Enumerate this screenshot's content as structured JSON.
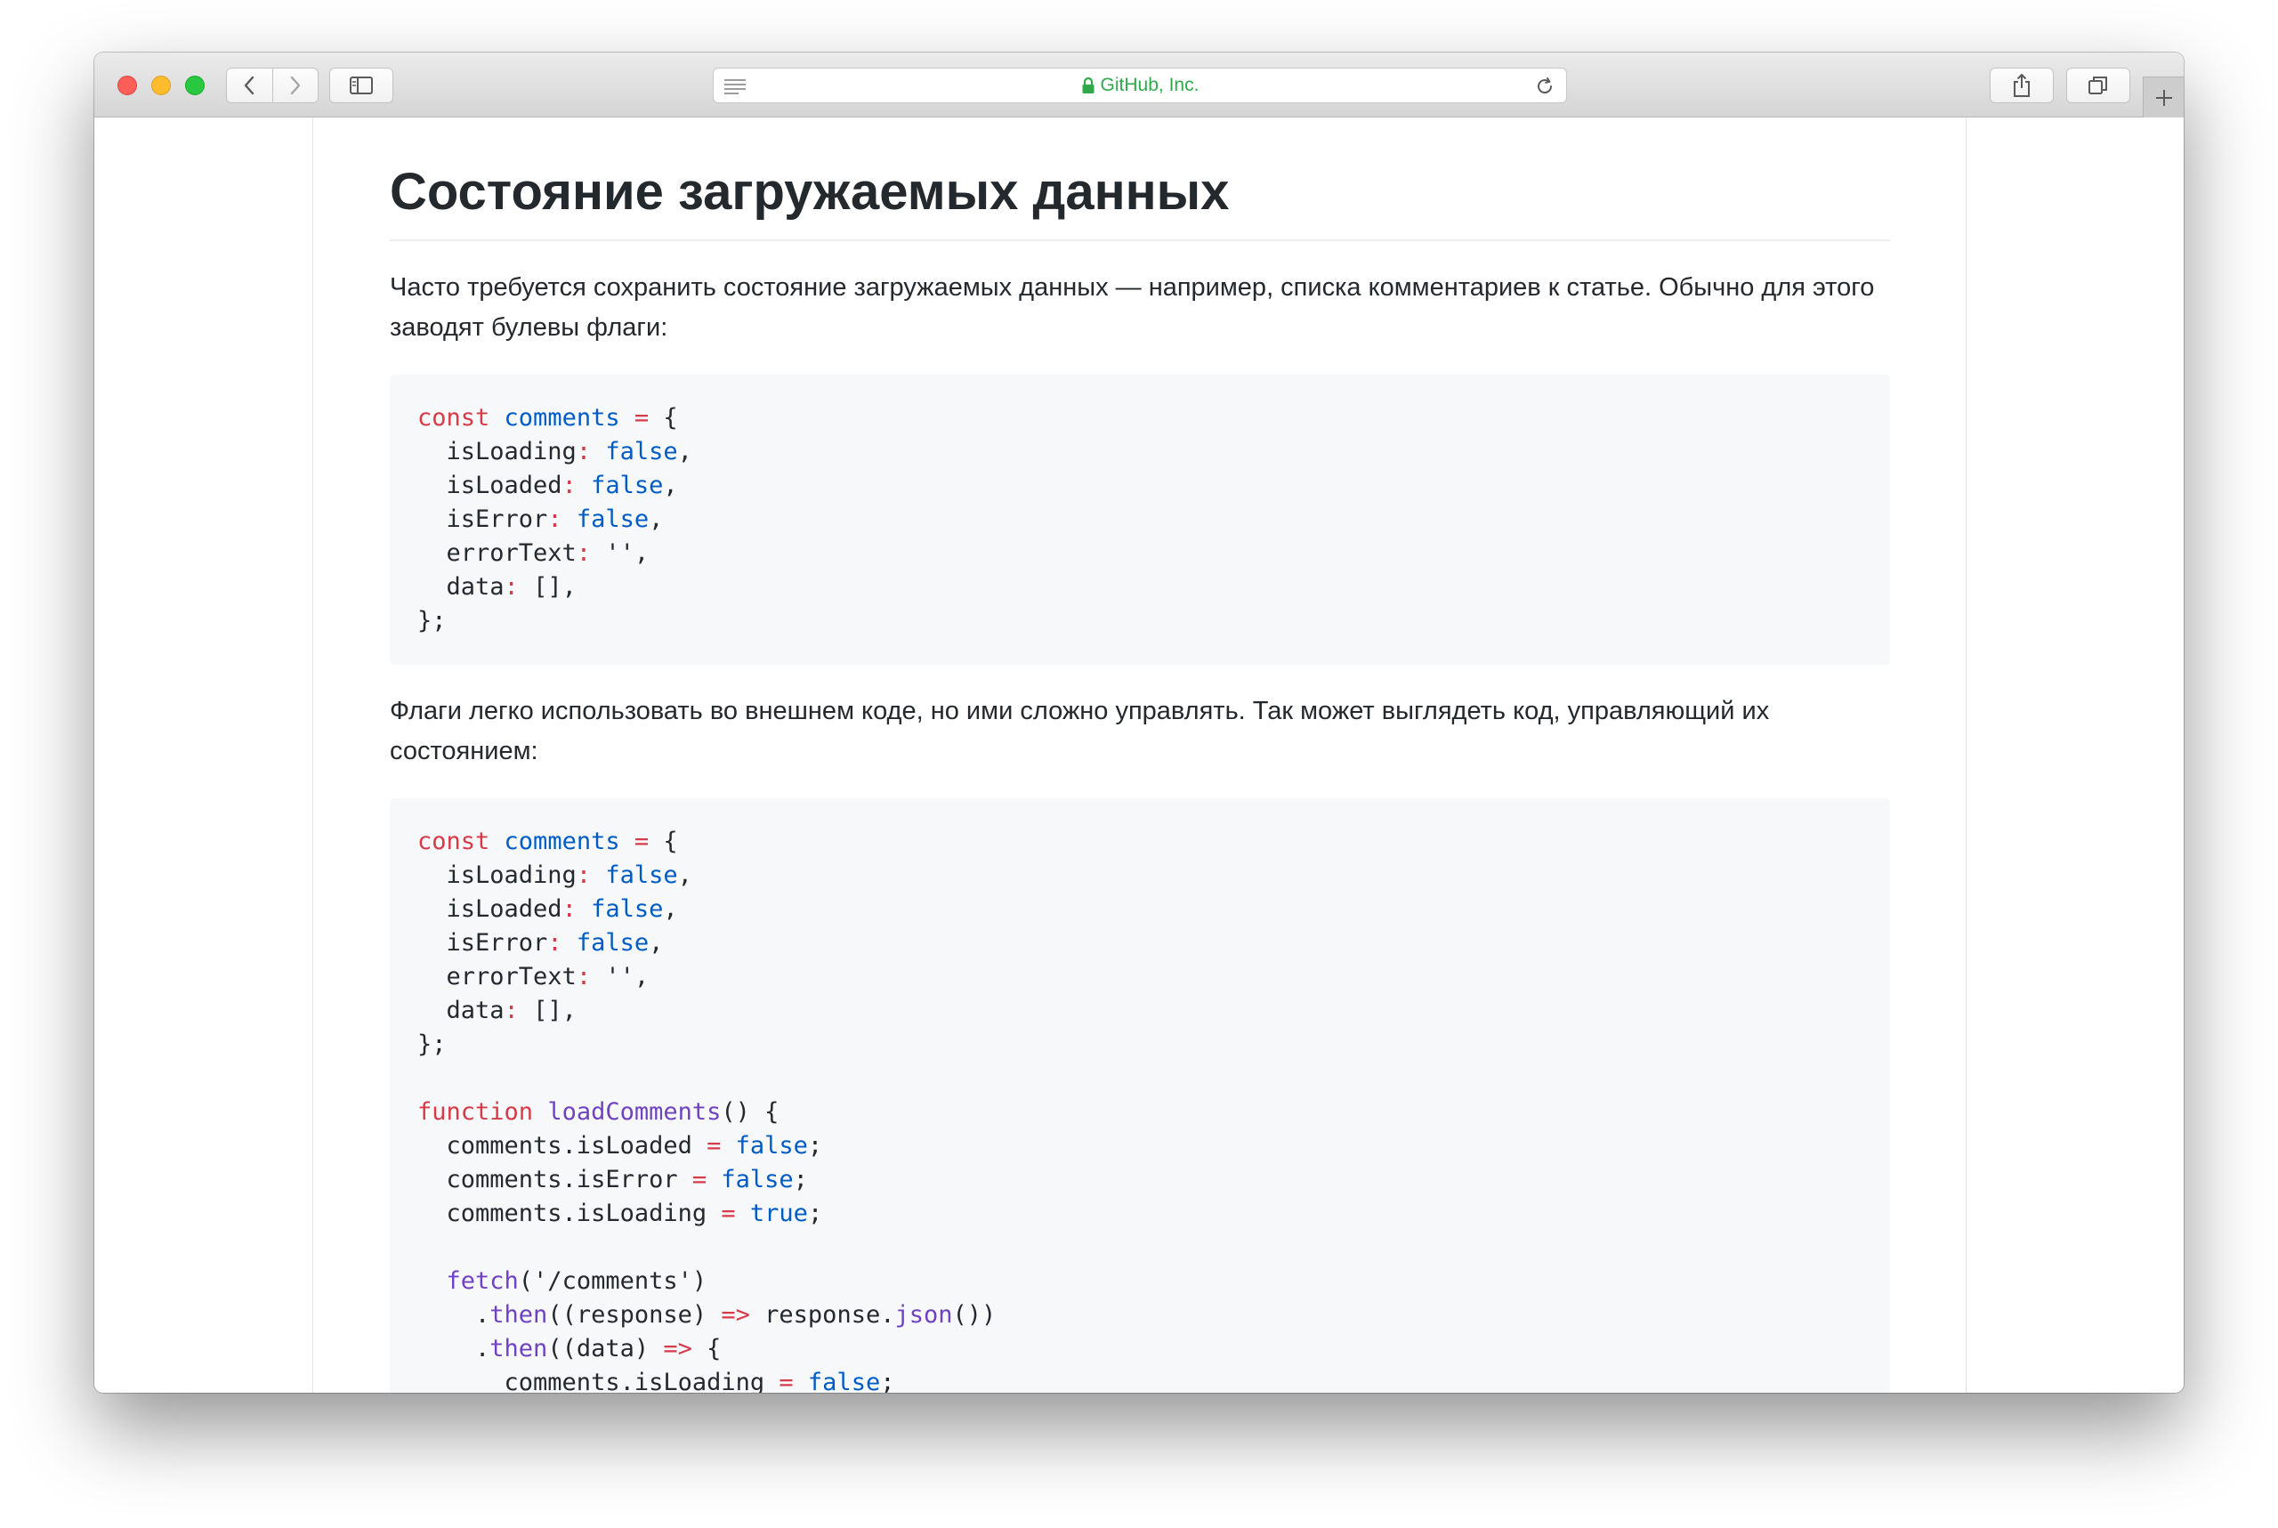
{
  "browser": {
    "site_name": "GitHub, Inc.",
    "icons": {
      "back": "chevron-left-icon",
      "forward": "chevron-right-icon",
      "sidebar": "sidebar-icon",
      "reader": "reader-icon",
      "lock": "lock-icon",
      "reload": "reload-icon",
      "share": "share-icon",
      "tabs": "tabs-overview-icon",
      "new_tab": "plus-icon"
    },
    "colors": {
      "site_label": "#2fa94a",
      "close": "#fc5f57",
      "minimize": "#fdbc2e",
      "zoom": "#28c840"
    }
  },
  "article": {
    "title": "Состояние загружаемых данных",
    "paragraph_1": "Часто требуется сохранить состояние загружаемых данных — например, списка комментариев к статье. Обычно для этого заводят булевы флаги:",
    "paragraph_2": "Флаги легко использовать во внешнем коде, но ими сложно управлять. Так может выглядеть код, управляющий их состоянием:",
    "code_1": {
      "l1": [
        "const",
        " ",
        "comments",
        " ",
        "=",
        " {"
      ],
      "l2": [
        "  isLoading",
        ":",
        " ",
        "false",
        ","
      ],
      "l3": [
        "  isLoaded",
        ":",
        " ",
        "false",
        ","
      ],
      "l4": [
        "  isError",
        ":",
        " ",
        "false",
        ","
      ],
      "l5": [
        "  errorText",
        ":",
        " '',"
      ],
      "l6": [
        "  data",
        ":",
        " [],"
      ],
      "l7": "};"
    },
    "code_2": {
      "l1": [
        "const",
        " ",
        "comments",
        " ",
        "=",
        " {"
      ],
      "l2": [
        "  isLoading",
        ":",
        " ",
        "false",
        ","
      ],
      "l3": [
        "  isLoaded",
        ":",
        " ",
        "false",
        ","
      ],
      "l4": [
        "  isError",
        ":",
        " ",
        "false",
        ","
      ],
      "l5": [
        "  errorText",
        ":",
        " '',"
      ],
      "l6": [
        "  data",
        ":",
        " [],"
      ],
      "l7": "};",
      "l9": [
        "function",
        " ",
        "loadComments",
        "() {"
      ],
      "l10": [
        "  comments.isLoaded ",
        "=",
        " ",
        "false",
        ";"
      ],
      "l11": [
        "  comments.isError ",
        "=",
        " ",
        "false",
        ";"
      ],
      "l12": [
        "  comments.isLoading ",
        "=",
        " ",
        "true",
        ";"
      ],
      "l14": [
        "  ",
        "fetch",
        "('/comments')"
      ],
      "l15": [
        "    .",
        "then",
        "((response) ",
        "=>",
        " response.",
        "json",
        "())"
      ],
      "l16": [
        "    .",
        "then",
        "((data) ",
        "=>",
        " {"
      ],
      "l17": [
        "      comments.isLoading ",
        "=",
        " ",
        "false",
        ";"
      ]
    },
    "syntax_colors": {
      "keyword": "#d73a49",
      "variable": "#005cc5",
      "function": "#6f42c1",
      "text": "#24292e",
      "code_background": "#f6f8fa"
    }
  }
}
